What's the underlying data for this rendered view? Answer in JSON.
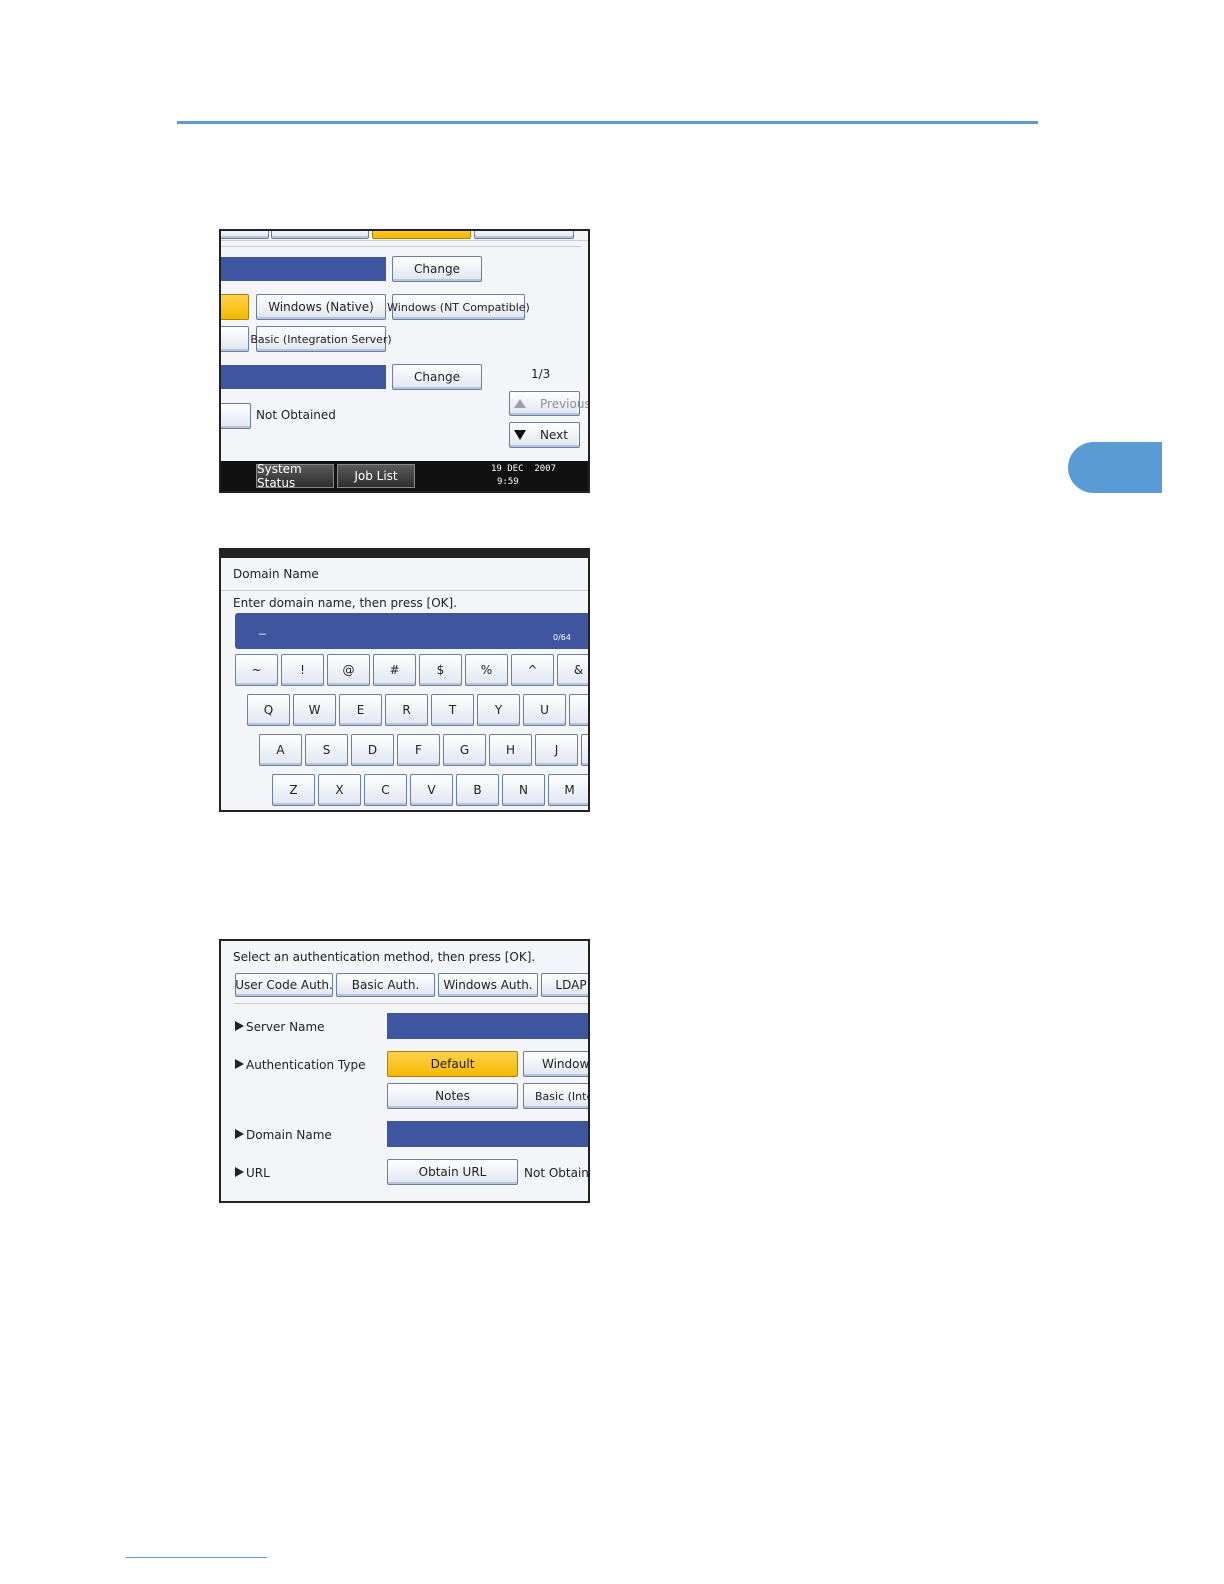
{
  "screen1": {
    "change_label_1": "Change",
    "windows_native": "Windows (Native)",
    "windows_nt": "Windows (NT Compatible)",
    "basic_integration": "Basic (Integration Server)",
    "change_label_2": "Change",
    "page_indicator": "1/3",
    "previous_label": "Previous",
    "next_label": "Next",
    "not_obtained": "Not Obtained",
    "system_status": "System Status",
    "job_list": "Job List",
    "date": "19 DEC  2007",
    "time": "9:59"
  },
  "screen2": {
    "title": "Domain Name",
    "instruction": "Enter domain name, then press [OK].",
    "input_value": "_",
    "char_count": "0/64",
    "rows": [
      [
        "~",
        "!",
        "@",
        "#",
        "$",
        "%",
        "^",
        "&"
      ],
      [
        "Q",
        "W",
        "E",
        "R",
        "T",
        "Y",
        "U",
        ""
      ],
      [
        "A",
        "S",
        "D",
        "F",
        "G",
        "H",
        "J",
        ""
      ],
      [
        "Z",
        "X",
        "C",
        "V",
        "B",
        "N",
        "M"
      ]
    ]
  },
  "screen3": {
    "instruction": "Select an authentication method, then press [OK].",
    "tabs": [
      "User Code Auth.",
      "Basic Auth.",
      "Windows Auth.",
      "LDAP"
    ],
    "server_name_label": "Server Name",
    "auth_type_label": "Authentication Type",
    "default_label": "Default",
    "windows_label": "Windows",
    "notes_label": "Notes",
    "basic_integ_label": "Basic (Integr",
    "domain_name_label": "Domain Name",
    "url_label": "URL",
    "obtain_url_label": "Obtain URL",
    "not_obtained": "Not Obtaine"
  }
}
